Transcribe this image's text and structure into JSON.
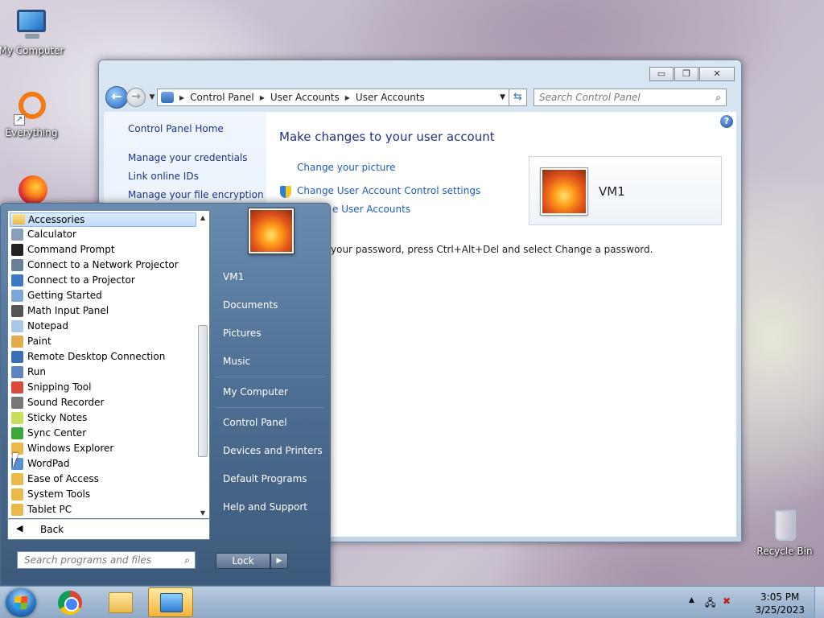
{
  "desktop": {
    "icons": [
      {
        "label": "My Computer",
        "icon": "computer-icon"
      },
      {
        "label": "Everything",
        "icon": "everything-icon"
      },
      {
        "label": "Recycle Bin",
        "icon": "recycle-bin-icon"
      }
    ]
  },
  "window": {
    "buttons": {
      "minimize": "▭",
      "maximize": "❐",
      "close": "✕"
    },
    "breadcrumb": [
      "Control Panel",
      "User Accounts",
      "User Accounts"
    ],
    "search_placeholder": "Search Control Panel",
    "sidebar": [
      "Control Panel Home",
      "Manage your credentials",
      "Link online IDs",
      "Manage your file encryption"
    ],
    "main": {
      "title": "Make changes to your user account",
      "links": [
        "Change your picture",
        "Change User Account Control settings",
        "e User Accounts"
      ],
      "note": "your password, press Ctrl+Alt+Del and select Change a password.",
      "user_name": "VM1"
    }
  },
  "start_menu": {
    "folder": "Accessories",
    "programs": [
      {
        "label": "Calculator",
        "color": "#8aa0b8"
      },
      {
        "label": "Command Prompt",
        "color": "#222222"
      },
      {
        "label": "Connect to a Network Projector",
        "color": "#6b7f99"
      },
      {
        "label": "Connect to a Projector",
        "color": "#3c78c8"
      },
      {
        "label": "Getting Started",
        "color": "#7aa8d8"
      },
      {
        "label": "Math Input Panel",
        "color": "#555555"
      },
      {
        "label": "Notepad",
        "color": "#a9c8e6"
      },
      {
        "label": "Paint",
        "color": "#e4a94a"
      },
      {
        "label": "Remote Desktop Connection",
        "color": "#3a6fb8"
      },
      {
        "label": "Run",
        "color": "#5d86c0"
      },
      {
        "label": "Snipping Tool",
        "color": "#d94a3a"
      },
      {
        "label": "Sound Recorder",
        "color": "#777777"
      },
      {
        "label": "Sticky Notes",
        "color": "#c6e05a"
      },
      {
        "label": "Sync Center",
        "color": "#3aa83a"
      },
      {
        "label": "Windows Explorer",
        "color": "#e9b94a"
      },
      {
        "label": "WordPad",
        "color": "#5a8fd0"
      },
      {
        "label": "Ease of Access",
        "color": "#e9b94a"
      },
      {
        "label": "System Tools",
        "color": "#e9b94a"
      },
      {
        "label": "Tablet PC",
        "color": "#e9b94a"
      }
    ],
    "back": "Back",
    "search_placeholder": "Search programs and files",
    "right": [
      "VM1",
      "Documents",
      "Pictures",
      "Music",
      "My Computer",
      "Control Panel",
      "Devices and Printers",
      "Default Programs",
      "Help and Support"
    ],
    "lock": "Lock"
  },
  "taskbar": {
    "time": "3:05 PM",
    "date": "3/25/2023"
  }
}
